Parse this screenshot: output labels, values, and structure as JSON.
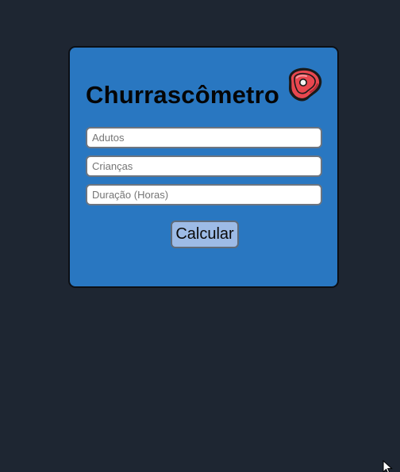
{
  "app": {
    "title": "Churrascômetro",
    "icon": "meat-steak-icon"
  },
  "form": {
    "adults": {
      "placeholder": "Adutos",
      "value": ""
    },
    "children": {
      "placeholder": "Crianças",
      "value": ""
    },
    "duration": {
      "placeholder": "Duração (Horas)",
      "value": ""
    },
    "submit_label": "Calcular"
  },
  "colors": {
    "page_background": "#1e2632",
    "card_background": "#2977c1",
    "button_background": "#9dbbe6",
    "meat_red": "#e8474f"
  }
}
